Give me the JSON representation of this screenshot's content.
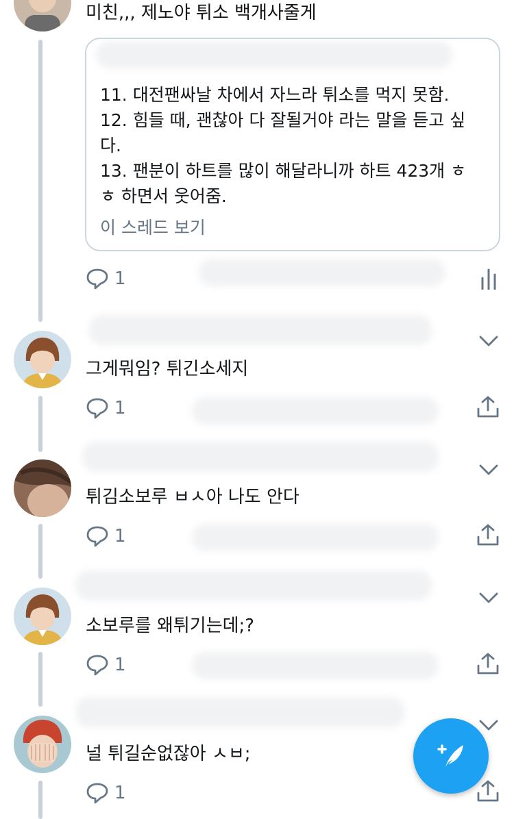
{
  "tweets": [
    {
      "text": "미친,,, 제노야 튀소 백개사줄게"
    },
    {
      "text": "그게뭐임? 튀긴소세지",
      "reply_count": "1"
    },
    {
      "text": "튀김소보루 ㅂㅅ아 나도 안다",
      "reply_count": "1"
    },
    {
      "text": "소보루를 왜튀기는데;?",
      "reply_count": "1"
    },
    {
      "text": "널 튀길순없잖아 ㅅㅂ;",
      "reply_count": "1"
    }
  ],
  "quote": {
    "lines": [
      "11. 대전팬싸날 차에서 자느라 튀소를 먹지 못함.",
      "12. 힘들 때, 괜찮아 다 잘될거야 라는 말을 듣고 싶",
      "다.",
      "13. 팬분이 하트를 많이 해달라니까 하트 423개 ㅎ",
      "ㅎ 하면서 웃어줌."
    ],
    "show_thread": "이 스레드 보기"
  },
  "first_tweet": {
    "reply_count": "1"
  },
  "colors": {
    "accent": "#1da1f2",
    "icon": "#657786",
    "thread_line": "#c8d1d9",
    "card_border": "#ccd6dd"
  },
  "icons": [
    "reply-icon",
    "share-icon",
    "analytics-icon",
    "chevron-down-icon",
    "compose-tweet-icon"
  ]
}
